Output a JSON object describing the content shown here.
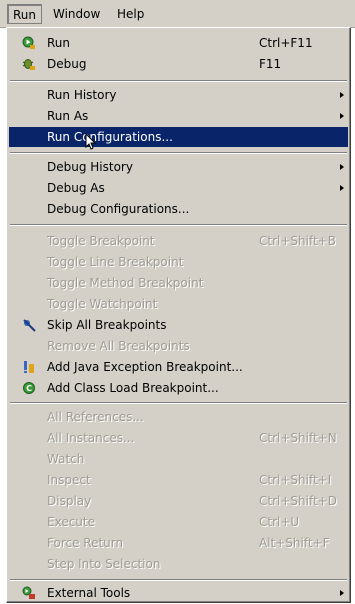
{
  "menubar": {
    "items": [
      {
        "label": "Run"
      },
      {
        "label": "Window"
      },
      {
        "label": "Help"
      }
    ]
  },
  "menu": {
    "groups": {
      "launch": [
        {
          "label": "Run",
          "accel": "Ctrl+F11",
          "icon": "run-icon"
        },
        {
          "label": "Debug",
          "accel": "F11",
          "icon": "debug-icon"
        }
      ],
      "run": [
        {
          "label": "Run History",
          "submenu": true
        },
        {
          "label": "Run As",
          "submenu": true
        },
        {
          "label": "Run Configurations...",
          "selected": true
        }
      ],
      "debug": [
        {
          "label": "Debug History",
          "submenu": true
        },
        {
          "label": "Debug As",
          "submenu": true
        },
        {
          "label": "Debug Configurations..."
        }
      ],
      "breakpoints": [
        {
          "label": "Toggle Breakpoint",
          "accel": "Ctrl+Shift+B",
          "disabled": true
        },
        {
          "label": "Toggle Line Breakpoint",
          "disabled": true
        },
        {
          "label": "Toggle Method Breakpoint",
          "disabled": true
        },
        {
          "label": "Toggle Watchpoint",
          "disabled": true
        },
        {
          "label": "Skip All Breakpoints",
          "icon": "skip-breakpoints-icon"
        },
        {
          "label": "Remove All Breakpoints",
          "disabled": true
        },
        {
          "label": "Add Java Exception Breakpoint...",
          "icon": "exception-breakpoint-icon"
        },
        {
          "label": "Add Class Load Breakpoint...",
          "icon": "class-load-breakpoint-icon"
        }
      ],
      "inspect": [
        {
          "label": "All References...",
          "disabled": true
        },
        {
          "label": "All Instances...",
          "accel": "Ctrl+Shift+N",
          "disabled": true
        },
        {
          "label": "Watch",
          "disabled": true
        },
        {
          "label": "Inspect",
          "accel": "Ctrl+Shift+I",
          "disabled": true
        },
        {
          "label": "Display",
          "accel": "Ctrl+Shift+D",
          "disabled": true
        },
        {
          "label": "Execute",
          "accel": "Ctrl+U",
          "disabled": true
        },
        {
          "label": "Force Return",
          "accel": "Alt+Shift+F",
          "disabled": true
        },
        {
          "label": "Step Into Selection",
          "disabled": true
        }
      ],
      "tools": [
        {
          "label": "External Tools",
          "submenu": true,
          "icon": "external-tools-icon"
        }
      ]
    }
  },
  "colors": {
    "menu_bg": "#d4d0c8",
    "selection_bg": "#0a246a",
    "disabled_text": "#a09c94"
  }
}
